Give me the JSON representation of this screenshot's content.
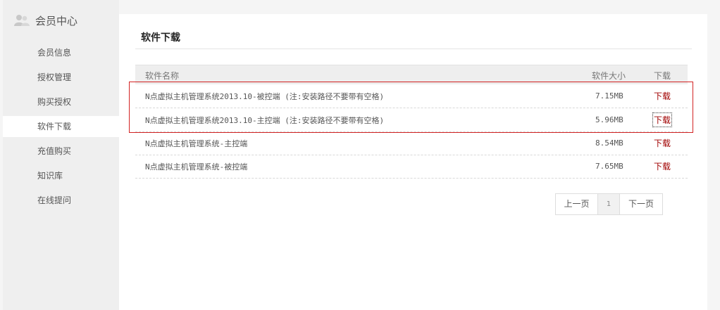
{
  "sidebar": {
    "title": "会员中心",
    "items": [
      {
        "label": "会员信息"
      },
      {
        "label": "授权管理"
      },
      {
        "label": "购买授权"
      },
      {
        "label": "软件下载"
      },
      {
        "label": "充值购买"
      },
      {
        "label": "知识库"
      },
      {
        "label": "在线提问"
      }
    ],
    "active": "软件下载"
  },
  "main": {
    "title": "软件下载",
    "table": {
      "headers": {
        "name": "软件名称",
        "size": "软件大小",
        "download": "下载"
      },
      "rows": [
        {
          "name": "N点虚拟主机管理系统2013.10-被控端 (注:安装路径不要带有空格)",
          "size": "7.15MB",
          "download": "下载"
        },
        {
          "name": "N点虚拟主机管理系统2013.10-主控端 (注:安装路径不要带有空格)",
          "size": "5.96MB",
          "download": "下载"
        },
        {
          "name": "N点虚拟主机管理系统-主控端",
          "size": "8.54MB",
          "download": "下载"
        },
        {
          "name": "N点虚拟主机管理系统-被控端",
          "size": "7.65MB",
          "download": "下载"
        }
      ]
    },
    "pager": {
      "prev": "上一页",
      "current": "1",
      "next": "下一页"
    }
  },
  "colors": {
    "download_link": "#a00000",
    "highlight_border": "#d22222",
    "sidebar_bg": "#efefef"
  },
  "icons": {
    "sidebar_title": "user-group-icon"
  }
}
